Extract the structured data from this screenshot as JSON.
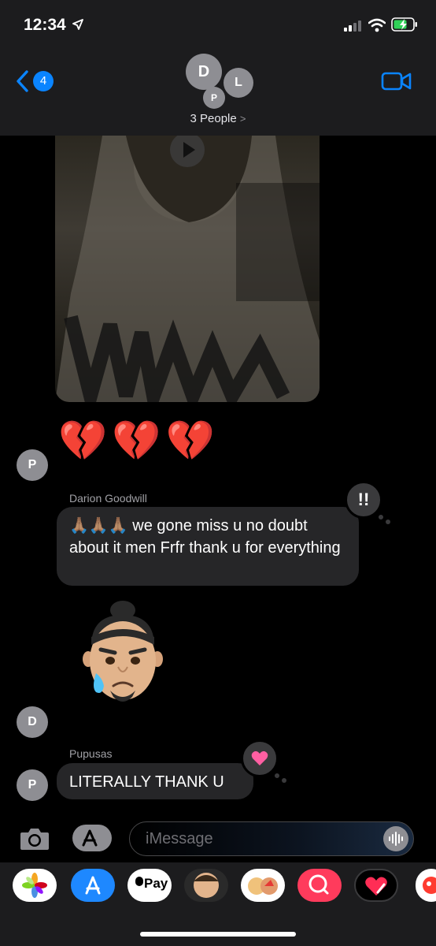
{
  "status_bar": {
    "time": "12:34"
  },
  "header": {
    "back_badge": "4",
    "avatars": [
      "D",
      "L",
      "P"
    ],
    "group_name": "3 People",
    "chevron": ">"
  },
  "messages": {
    "hearts": "💔💔💔",
    "avatar_p1": "P",
    "msg1_sender": "Darion Goodwill",
    "msg1_text": "🙏🏽🙏🏽🙏🏽 we gone miss u no doubt about it men Frfr thank u for everything",
    "msg1_tapback": "!!",
    "avatar_d": "D",
    "msg2_sender": "Pupusas",
    "msg2_text": "LITERALLY THANK U",
    "avatar_p2": "P"
  },
  "input": {
    "placeholder": "iMessage"
  },
  "app_strip": {
    "apple_pay": "Pay",
    "apps": [
      "photos-icon",
      "app-store-icon",
      "apple-pay-icon",
      "memoji-icon",
      "memoji-stickers-icon",
      "search-images-icon",
      "digital-touch-icon",
      "more-stickers-icon"
    ]
  },
  "colors": {
    "accent": "#0a84ff",
    "bubble": "#262628",
    "bar": "#1c1c1e"
  }
}
